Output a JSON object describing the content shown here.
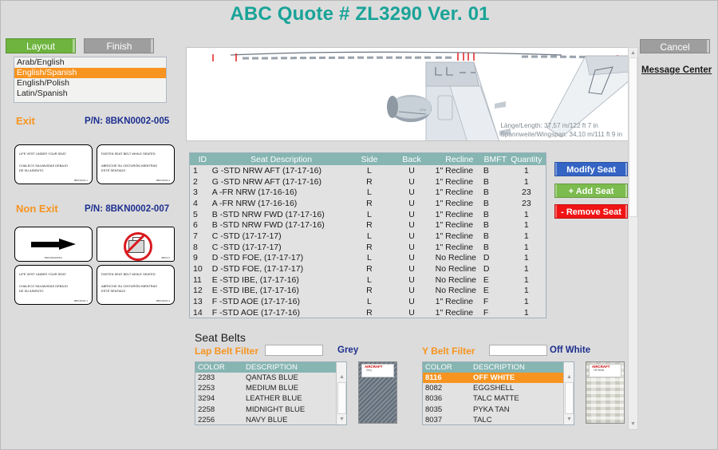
{
  "header": {
    "title": "ABC Quote # ZL3290 Ver. 01",
    "title_color": "#19a398",
    "cancel_label": "Cancel",
    "message_center_label": "Message  Center"
  },
  "tabs": [
    {
      "label": "Layout",
      "active": true,
      "color": "#6eb43f"
    },
    {
      "label": "Finish",
      "active": false,
      "color": "#9e9e9e"
    }
  ],
  "language_list": {
    "items": [
      {
        "label": "Arab/English",
        "selected": false
      },
      {
        "label": "English/Spanish",
        "selected": true
      },
      {
        "label": "English/Polish",
        "selected": false
      },
      {
        "label": "Latin/Spanish",
        "selected": false
      }
    ],
    "selected_color": "#f79420"
  },
  "placards": {
    "exit": {
      "section_label": "Exit",
      "part_number": "P/N: 8BKN0002-005",
      "cards": [
        {
          "lines": [
            "LIFE VEST UNDER YOUR SEAT",
            "CHALECO SALVAVIDAS DEBAJO",
            "DE SU ASIENTO"
          ],
          "code": "8BKN0002-1"
        },
        {
          "lines": [
            "FASTEN SEAT BELT WHILE SEATED",
            "ABROCHE SU CINTURÓN MIENTRAS",
            "ESTÉ SENTADO"
          ],
          "code": "8BKN0002-2"
        }
      ]
    },
    "non_exit": {
      "section_label": "Non Exit",
      "part_number": "P/N: 8BKN0002-007",
      "cards": [
        {
          "icon": "right-arrow-icon",
          "code": "8BKN0002008-6"
        },
        {
          "icon": "no-baggage-icon",
          "code": "8BKN-5"
        },
        {
          "lines": [
            "LIFE VEST UNDER YOUR SEAT",
            "CHALECO SALVAVIDAS DEBAJO",
            "DE SU ASIENTO"
          ],
          "code": "8BKN0002-1"
        },
        {
          "lines": [
            "FASTEN SEAT BELT WHILE SEATED",
            "ABROCHE SU CINTURÓN MIENTRAS",
            "ESTÉ SENTADO"
          ],
          "code": "8BKN0002-2"
        }
      ]
    }
  },
  "diagram": {
    "length_text": "Länge/Length: 37,57 m/122 ft 7 in",
    "wingspan_text": "Spannweite/Wingspan: 34,10 m/111 ft 9 in"
  },
  "seat_table": {
    "headers": [
      "ID",
      "Seat Description",
      "Side",
      "Back",
      "Recline",
      "BMFT",
      "Quantity"
    ],
    "header_bg": "#86b5b2",
    "rows": [
      {
        "id": "1",
        "desc": "G -STD NRW AFT (17-17-16)",
        "side": "L",
        "back": "U",
        "recline": "1\" Recline",
        "bmft": "B",
        "qty": "1"
      },
      {
        "id": "2",
        "desc": "G -STD NRW AFT (17-17-16)",
        "side": "R",
        "back": "U",
        "recline": "1\" Recline",
        "bmft": "B",
        "qty": "1"
      },
      {
        "id": "3",
        "desc": "A -FR NRW (17-16-16)",
        "side": "L",
        "back": "U",
        "recline": "1\" Recline",
        "bmft": "B",
        "qty": "23"
      },
      {
        "id": "4",
        "desc": "A -FR NRW (17-16-16)",
        "side": "R",
        "back": "U",
        "recline": "1\" Recline",
        "bmft": "B",
        "qty": "23"
      },
      {
        "id": "5",
        "desc": "B -STD NRW FWD (17-17-16)",
        "side": "L",
        "back": "U",
        "recline": "1\" Recline",
        "bmft": "B",
        "qty": "1"
      },
      {
        "id": "6",
        "desc": "B -STD NRW FWD (17-17-16)",
        "side": "R",
        "back": "U",
        "recline": "1\" Recline",
        "bmft": "B",
        "qty": "1"
      },
      {
        "id": "7",
        "desc": "C -STD (17-17-17)",
        "side": "L",
        "back": "U",
        "recline": "1\" Recline",
        "bmft": "B",
        "qty": "1"
      },
      {
        "id": "8",
        "desc": "C -STD (17-17-17)",
        "side": "R",
        "back": "U",
        "recline": "1\" Recline",
        "bmft": "B",
        "qty": "1"
      },
      {
        "id": "9",
        "desc": "D -STD FOE, (17-17-17)",
        "side": "L",
        "back": "U",
        "recline": "No Recline",
        "bmft": "D",
        "qty": "1"
      },
      {
        "id": "10",
        "desc": "D -STD FOE, (17-17-17)",
        "side": "R",
        "back": "U",
        "recline": "No Recline",
        "bmft": "D",
        "qty": "1"
      },
      {
        "id": "11",
        "desc": "E -STD IBE, (17-17-16)",
        "side": "L",
        "back": "U",
        "recline": "No Recline",
        "bmft": "E",
        "qty": "1"
      },
      {
        "id": "12",
        "desc": "E -STD IBE, (17-17-16)",
        "side": "R",
        "back": "U",
        "recline": "No Recline",
        "bmft": "E",
        "qty": "1"
      },
      {
        "id": "13",
        "desc": "F -STD AOE (17-17-16)",
        "side": "L",
        "back": "U",
        "recline": "1\" Recline",
        "bmft": "F",
        "qty": "1"
      },
      {
        "id": "14",
        "desc": "F -STD AOE (17-17-16)",
        "side": "R",
        "back": "U",
        "recline": "1\" Recline",
        "bmft": "F",
        "qty": "1"
      }
    ]
  },
  "actions": {
    "modify": {
      "label": "Modify Seat",
      "color": "#3464c4"
    },
    "add": {
      "label": "+ Add Seat",
      "color": "#7cbb4e"
    },
    "remove": {
      "label": "- Remove Seat",
      "color": "#f01414"
    }
  },
  "seat_belts": {
    "title": "Seat Belts",
    "lap": {
      "filter_label": "Lap Belt Filter",
      "filter_value": "",
      "filter_placeholder": "",
      "selected_color_name": "Grey",
      "columns": [
        "COLOR",
        "DESCRIPTION"
      ],
      "rows": [
        {
          "color": "2283",
          "description": "QANTAS BLUE",
          "selected": false
        },
        {
          "color": "2253",
          "description": "MEDIUM BLUE",
          "selected": false
        },
        {
          "color": "3294",
          "description": "LEATHER BLUE",
          "selected": false
        },
        {
          "color": "2258",
          "description": "MIDNIGHT BLUE",
          "selected": false
        },
        {
          "color": "2256",
          "description": "NAVY BLUE",
          "selected": false
        }
      ],
      "swatch_brand": "AIRCRAFT",
      "swatch_sub": "Grey"
    },
    "y": {
      "filter_label": "Y Belt Filter",
      "filter_value": "",
      "filter_placeholder": "",
      "selected_color_name": "Off White",
      "columns": [
        "COLOR",
        "DESCRIPTION"
      ],
      "rows": [
        {
          "color": "8116",
          "description": "OFF WHITE",
          "selected": true
        },
        {
          "color": "8082",
          "description": "EGGSHELL",
          "selected": false
        },
        {
          "color": "8036",
          "description": "TALC MATTE",
          "selected": false
        },
        {
          "color": "8035",
          "description": "PYKA TAN",
          "selected": false
        },
        {
          "color": "8037",
          "description": "TALC",
          "selected": false
        }
      ],
      "swatch_brand": "AIRCRAFT",
      "swatch_sub": "Off White"
    }
  }
}
